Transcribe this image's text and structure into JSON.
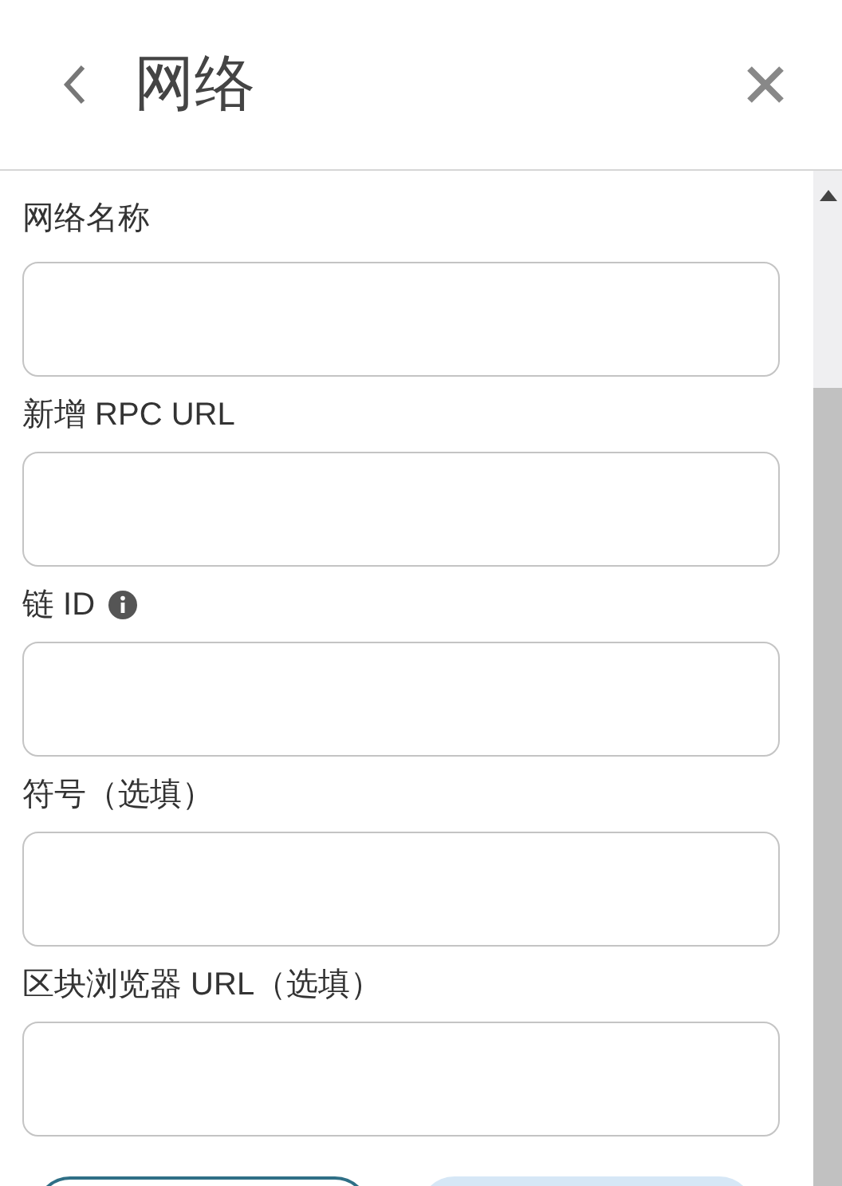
{
  "header": {
    "title": "网络"
  },
  "fields": [
    {
      "label": "网络名称",
      "info": false
    },
    {
      "label": "新增 RPC URL",
      "info": false
    },
    {
      "label": "链 ID",
      "info": true
    },
    {
      "label": "符号（选填）",
      "info": false
    },
    {
      "label": "区块浏览器 URL（选填）",
      "info": false
    }
  ]
}
